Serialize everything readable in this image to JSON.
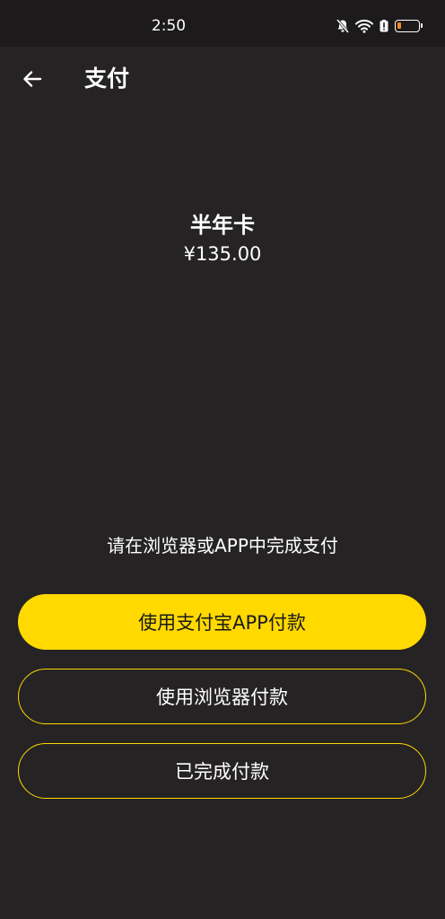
{
  "status_bar": {
    "time": "2:50",
    "icons": [
      "bell-muted-icon",
      "wifi-icon",
      "battery-saver-icon",
      "battery-icon"
    ],
    "battery_level": 0.18
  },
  "header": {
    "back_icon": "arrow-left-icon",
    "title": "支付"
  },
  "product": {
    "name": "半年卡",
    "price": "¥135.00"
  },
  "hint": "请在浏览器或APP中完成支付",
  "actions": {
    "alipay_label": "使用支付宝APP付款",
    "browser_label": "使用浏览器付款",
    "done_label": "已完成付款"
  },
  "colors": {
    "background": "#262325",
    "accent": "#ffd900",
    "battery": "#f08a1c"
  }
}
